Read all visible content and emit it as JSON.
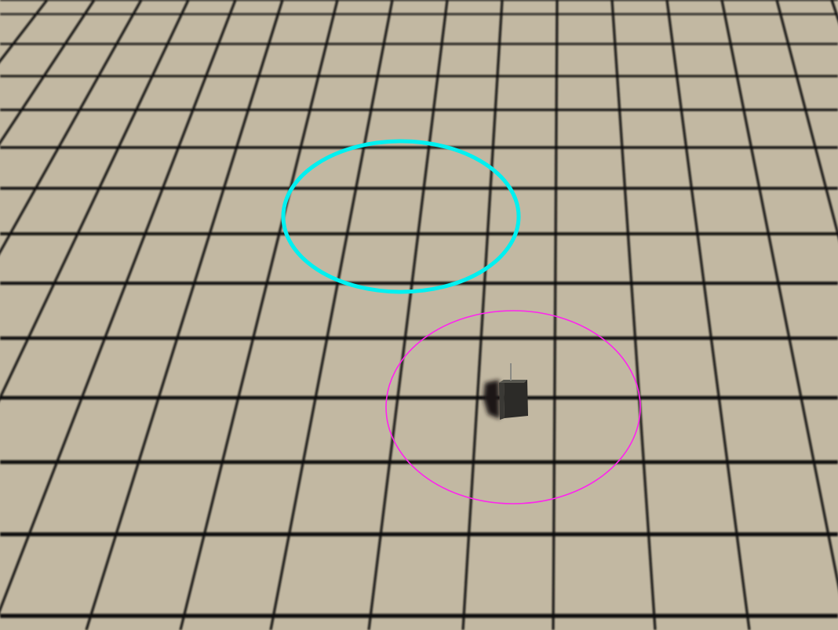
{
  "scene": {
    "description_free": true,
    "colors": {
      "floor": "#c2b8a2",
      "grid_line": "#0d0b08",
      "target_ring": "#00f0f0",
      "agent_ring": "#ff22ee",
      "agent_body_side": "#3a3935",
      "agent_body_front": "#2c2b28",
      "agent_body_top": "#57564f",
      "agent_shadow": "#1a1917",
      "antenna": "#8a8a84"
    },
    "icons": {
      "target_marker": "target-ring-icon",
      "agent": "agent-cube-icon"
    }
  }
}
